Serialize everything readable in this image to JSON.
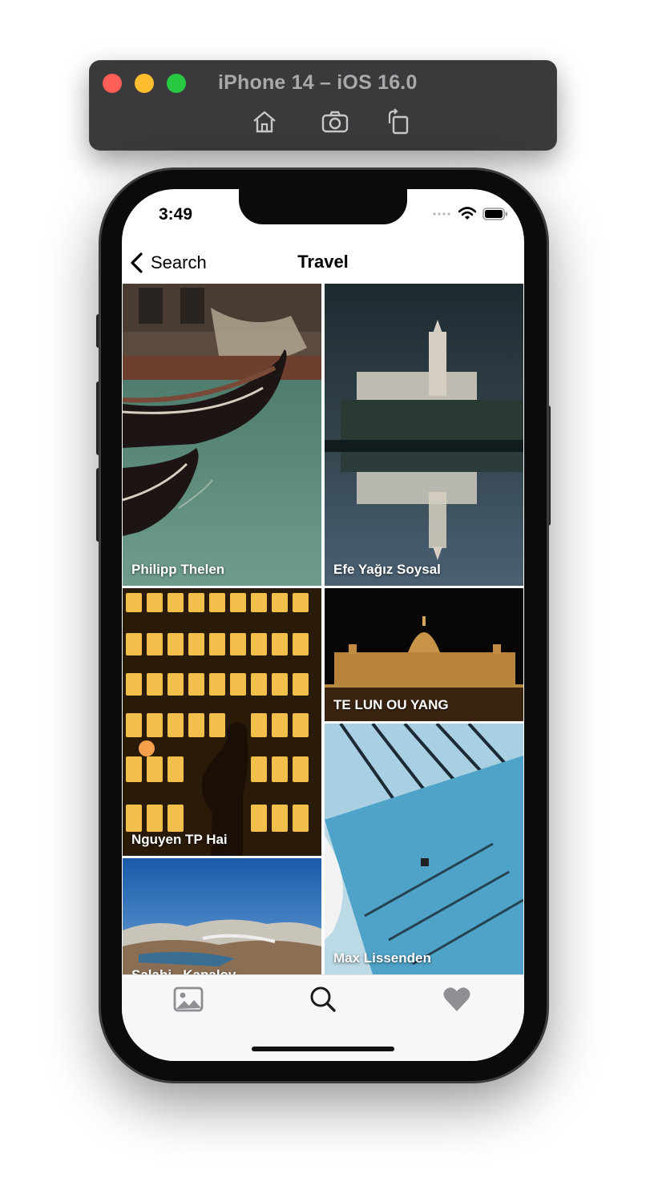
{
  "simulator": {
    "title": "iPhone 14 – iOS 16.0",
    "buttons": [
      "home-icon",
      "screenshot-icon",
      "rotate-icon"
    ]
  },
  "status_bar": {
    "time": "3:49"
  },
  "nav": {
    "back_label": "Search",
    "title": "Travel"
  },
  "photos": [
    {
      "author": "Philipp Thelen",
      "subject": "gondolas"
    },
    {
      "author": "Efe Yağız Soysal",
      "subject": "reflected palace"
    },
    {
      "author": "Nguyen TP Hai",
      "subject": "lanterns"
    },
    {
      "author": "TE LUN OU YANG",
      "subject": "parliament at night"
    },
    {
      "author": "Max Lissenden",
      "subject": "pool aerial"
    },
    {
      "author": "Salahi...Kapalov",
      "subject": "mountains"
    }
  ],
  "tabs": [
    {
      "name": "photos",
      "icon": "photo-icon",
      "active": false
    },
    {
      "name": "search",
      "icon": "search-icon",
      "active": true
    },
    {
      "name": "favorites",
      "icon": "heart-icon",
      "active": false
    }
  ],
  "colors": {
    "tab_active": "#1c1c1e",
    "tab_inactive": "#8e8e93",
    "sim_bar": "#3a3a3c"
  }
}
